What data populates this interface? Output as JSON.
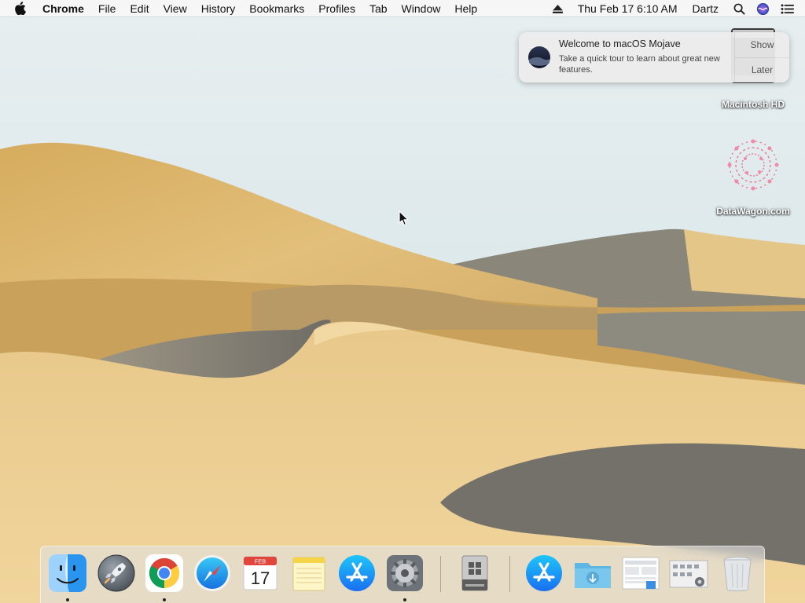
{
  "menubar": {
    "app_name": "Chrome",
    "menus": [
      "File",
      "Edit",
      "View",
      "History",
      "Bookmarks",
      "Profiles",
      "Tab",
      "Window",
      "Help"
    ],
    "datetime": "Thu Feb 17  6:10 AM",
    "user": "Dartz",
    "icons": [
      "apple-icon",
      "eject-icon",
      "spotlight-search-icon",
      "siri-icon",
      "notification-center-icon"
    ]
  },
  "notification": {
    "title": "Welcome to macOS Mojave",
    "body": "Take a quick tour to learn about great new features.",
    "show_label": "Show",
    "later_label": "Later",
    "icon": "mojave-icon"
  },
  "desktop": {
    "icons": [
      {
        "label": "Macintosh HD",
        "icon": "hard-drive-icon"
      },
      {
        "label": "DataWagon.com",
        "icon": "datawagon-icon"
      }
    ]
  },
  "dock": {
    "apps": [
      {
        "name": "Finder",
        "icon": "finder-icon",
        "running": true
      },
      {
        "name": "Launchpad",
        "icon": "launchpad-icon",
        "running": false
      },
      {
        "name": "Google Chrome",
        "icon": "chrome-icon",
        "running": true
      },
      {
        "name": "Safari",
        "icon": "safari-icon",
        "running": false
      },
      {
        "name": "Calendar",
        "icon": "calendar-icon",
        "running": false,
        "month": "FEB",
        "day": "17"
      },
      {
        "name": "Notes",
        "icon": "notes-icon",
        "running": false
      },
      {
        "name": "App Store",
        "icon": "app-store-icon",
        "running": false
      },
      {
        "name": "System Preferences",
        "icon": "system-preferences-icon",
        "running": true
      },
      {
        "name": "Boot Camp Assistant",
        "icon": "boot-camp-icon",
        "running": false
      },
      {
        "name": "App Store download",
        "icon": "app-store-download-icon",
        "running": false
      },
      {
        "name": "Downloads",
        "icon": "downloads-folder-icon",
        "running": false
      },
      {
        "name": "Document stack",
        "icon": "document-stack-icon",
        "running": false
      },
      {
        "name": "System Preferences stack",
        "icon": "preferences-stack-icon",
        "running": false
      },
      {
        "name": "Trash",
        "icon": "trash-icon",
        "running": false
      }
    ]
  },
  "colors": {
    "sky": "#dfe9ec",
    "sand": "#d9b36a",
    "sand_shadow": "#7d7a72"
  }
}
